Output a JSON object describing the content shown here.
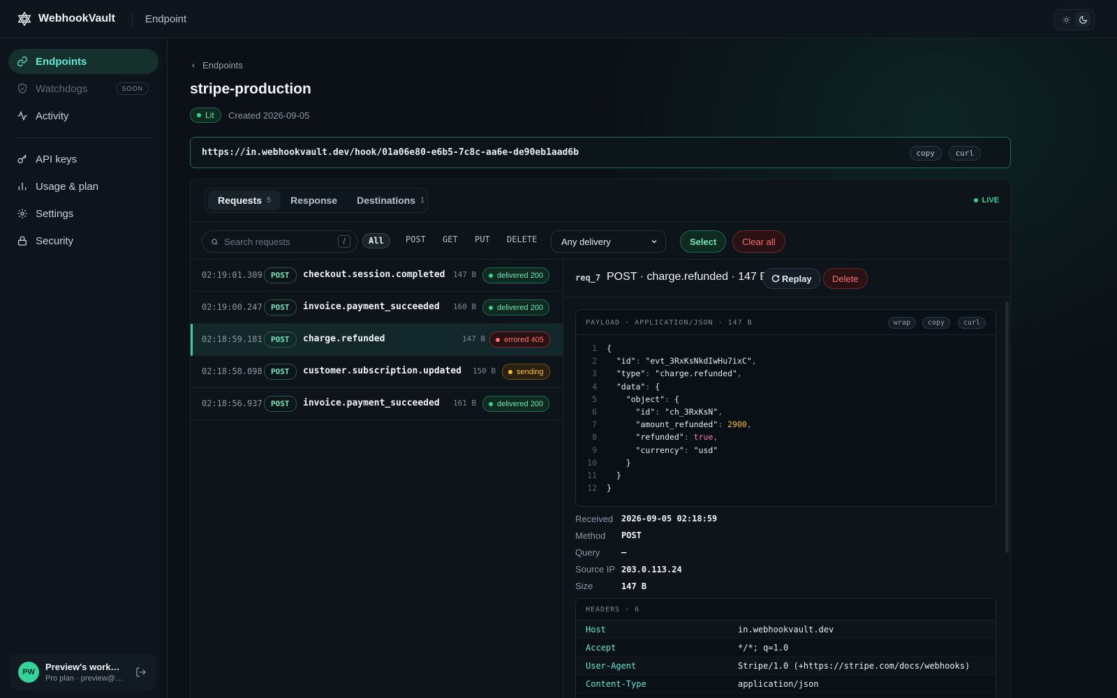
{
  "app": {
    "brand": "WebhookVault",
    "section": "Endpoint"
  },
  "sidebar": {
    "items": [
      {
        "label": "Endpoints",
        "icon": "link-icon",
        "active": true
      },
      {
        "label": "Watchdogs",
        "icon": "shield-icon",
        "badge": "SOON",
        "disabled": true
      },
      {
        "label": "Activity",
        "icon": "activity-icon"
      },
      {
        "label": "API keys",
        "icon": "key-icon"
      },
      {
        "label": "Usage & plan",
        "icon": "bar-chart-icon"
      },
      {
        "label": "Settings",
        "icon": "gear-icon"
      },
      {
        "label": "Security",
        "icon": "lock-icon"
      }
    ],
    "workspace": {
      "initials": "PW",
      "name": "Preview's workspace",
      "plan": "Pro plan · preview@webhookvault.dev"
    }
  },
  "endpoint": {
    "breadcrumb": "Endpoints",
    "name": "stripe-production",
    "status": "Lit",
    "created": "Created 2026-09-05",
    "url": "https://in.webhookvault.dev/hook/01a06e80-e6b5-7c8c-aa6e-de90eb1aad6b",
    "copy_label": "copy",
    "curl_label": "curl"
  },
  "tabs": [
    {
      "label": "Requests",
      "count": "5",
      "active": true
    },
    {
      "label": "Response",
      "count": ""
    },
    {
      "label": "Destinations",
      "count": "1"
    }
  ],
  "live_label": "LIVE",
  "filters": {
    "search_placeholder": "Search requests",
    "search_shortcut": "/",
    "methods": [
      "All",
      "POST",
      "GET",
      "PUT",
      "DELETE"
    ],
    "active_method": "All",
    "delivery_selected": "Any delivery",
    "select_label": "Select",
    "clear_label": "Clear all"
  },
  "requests": [
    {
      "time": "02:19:01.309",
      "method": "POST",
      "event": "checkout.session.completed",
      "size": "147 B",
      "status": "delivered 200",
      "kind": "ok"
    },
    {
      "time": "02:19:00.247",
      "method": "POST",
      "event": "invoice.payment_succeeded",
      "size": "160 B",
      "status": "delivered 200",
      "kind": "ok"
    },
    {
      "time": "02:18:59.181",
      "method": "POST",
      "event": "charge.refunded",
      "size": "147 B",
      "status": "errored 405",
      "kind": "err",
      "selected": true
    },
    {
      "time": "02:18:58.098",
      "method": "POST",
      "event": "customer.subscription.updated",
      "size": "150 B",
      "status": "sending",
      "kind": "send"
    },
    {
      "time": "02:18:56.937",
      "method": "POST",
      "event": "invoice.payment_succeeded",
      "size": "161 B",
      "status": "delivered 200",
      "kind": "ok"
    }
  ],
  "detail": {
    "id": "req_7",
    "title": "POST · charge.refunded · 147 B",
    "replay_label": "Replay",
    "delete_label": "Delete",
    "payload_label": "PAYLOAD · APPLICATION/JSON · 147 B",
    "payload_chips": [
      "wrap",
      "copy",
      "curl"
    ],
    "meta": [
      {
        "label": "Received",
        "value": "2026-09-05 02:18:59"
      },
      {
        "label": "Method",
        "value": "POST"
      },
      {
        "label": "Query",
        "value": "—"
      },
      {
        "label": "Source IP",
        "value": "203.0.113.24"
      },
      {
        "label": "Size",
        "value": "147 B"
      }
    ],
    "headers_label": "HEADERS · 6",
    "headers": [
      {
        "key": "Host",
        "value": "in.webhookvault.dev"
      },
      {
        "key": "Accept",
        "value": "*/*; q=1.0"
      },
      {
        "key": "User-Agent",
        "value": "Stripe/1.0 (+https://stripe.com/docs/webhooks)"
      },
      {
        "key": "Content-Type",
        "value": "application/json"
      }
    ]
  },
  "payload_lines": [
    "{",
    "  \"id\": \"evt_3RxKsNkdIwHu7ixC\",",
    "  \"type\": \"charge.refunded\",",
    "  \"data\": {",
    "    \"object\": {",
    "      \"id\": \"ch_3RxKsN\",",
    "      \"amount_refunded\": 2900,",
    "      \"refunded\": true,",
    "      \"currency\": \"usd\"",
    "    }",
    "  }",
    "}"
  ],
  "colors": {
    "accent": "#34d399",
    "error": "#f87171",
    "warning": "#fbbf24",
    "background": "#0b1117"
  }
}
